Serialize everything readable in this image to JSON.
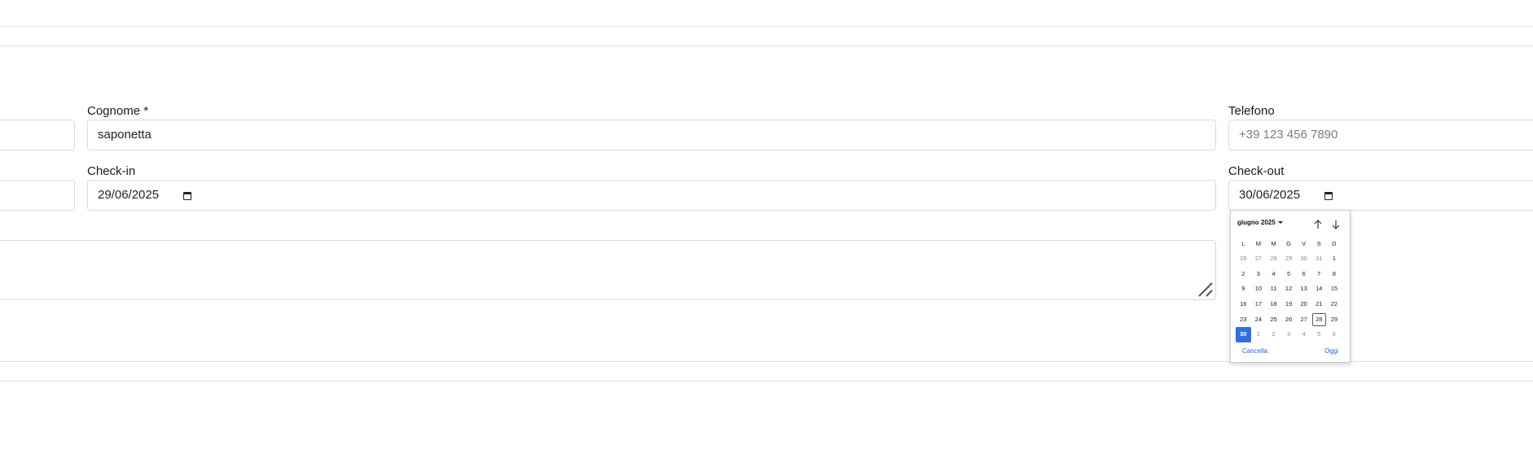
{
  "form": {
    "cognome_label": "Cognome *",
    "cognome_value": "saponetta",
    "telefono_label": "Telefono",
    "telefono_placeholder": "+39 123 456 7890",
    "checkin_label": "Check-in",
    "checkin_value": "29/06/2025",
    "checkout_label": "Check-out",
    "checkout_value": "30/06/2025"
  },
  "calendar": {
    "month_label": "giugno 2025",
    "weekdays": [
      "L",
      "M",
      "M",
      "G",
      "V",
      "S",
      "D"
    ],
    "days": [
      {
        "d": "26",
        "muted": true
      },
      {
        "d": "27",
        "muted": true
      },
      {
        "d": "28",
        "muted": true
      },
      {
        "d": "29",
        "muted": true
      },
      {
        "d": "30",
        "muted": true
      },
      {
        "d": "31",
        "muted": true
      },
      {
        "d": "1"
      },
      {
        "d": "2"
      },
      {
        "d": "3"
      },
      {
        "d": "4"
      },
      {
        "d": "5"
      },
      {
        "d": "6"
      },
      {
        "d": "7"
      },
      {
        "d": "8"
      },
      {
        "d": "9"
      },
      {
        "d": "10"
      },
      {
        "d": "11"
      },
      {
        "d": "12"
      },
      {
        "d": "13"
      },
      {
        "d": "14"
      },
      {
        "d": "15"
      },
      {
        "d": "16"
      },
      {
        "d": "17"
      },
      {
        "d": "18"
      },
      {
        "d": "19"
      },
      {
        "d": "20"
      },
      {
        "d": "21"
      },
      {
        "d": "22"
      },
      {
        "d": "23"
      },
      {
        "d": "24"
      },
      {
        "d": "25"
      },
      {
        "d": "26"
      },
      {
        "d": "27"
      },
      {
        "d": "28",
        "today": true
      },
      {
        "d": "29"
      },
      {
        "d": "30",
        "selected": true
      },
      {
        "d": "1",
        "muted": true
      },
      {
        "d": "2",
        "muted": true
      },
      {
        "d": "3",
        "muted": true
      },
      {
        "d": "4",
        "muted": true
      },
      {
        "d": "5",
        "muted": true
      },
      {
        "d": "6",
        "muted": true
      }
    ],
    "cancel_label": "Cancella",
    "today_label": "Oggi",
    "icons": {
      "prev": "arrow-up-icon",
      "next": "arrow-down-icon"
    }
  },
  "colors": {
    "accent": "#2f6fe0",
    "border": "#d9d9d9",
    "link": "#1a66d9"
  }
}
